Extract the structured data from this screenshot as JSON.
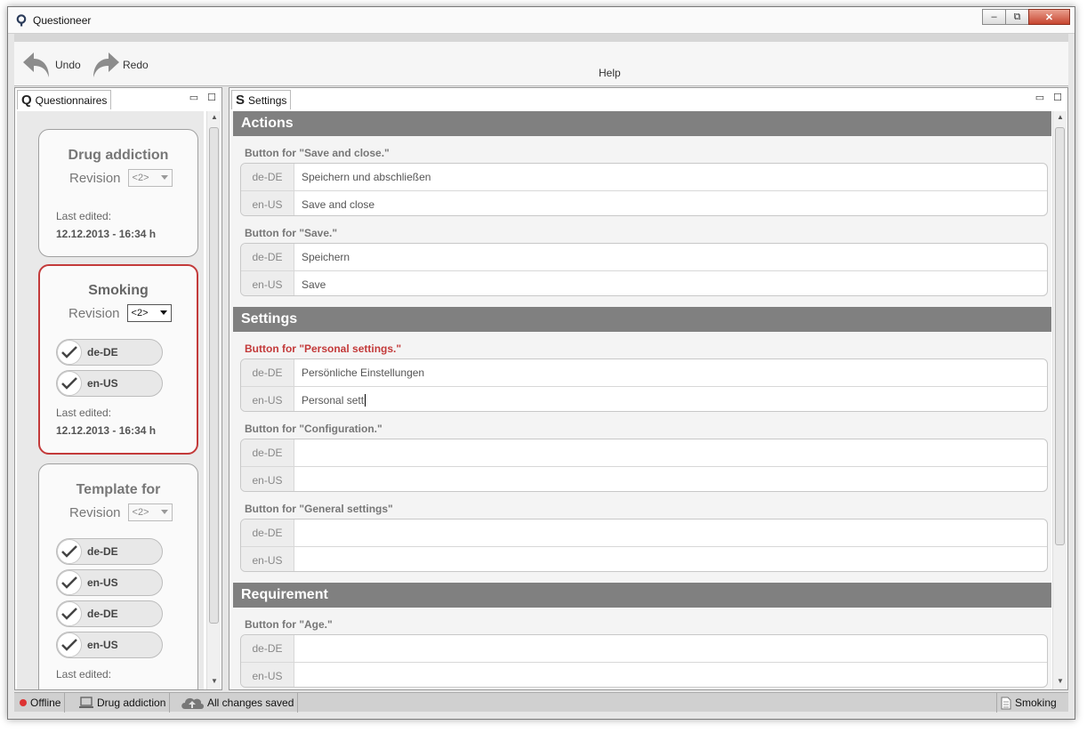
{
  "window": {
    "title": "Questioneer",
    "minimize": "‒",
    "maximize": "⧉",
    "close": "✕"
  },
  "toolbar": {
    "undo_label": "Undo",
    "redo_label": "Redo",
    "help_label": "Help"
  },
  "left_panel": {
    "tab_glyph": "Q",
    "tab_label": "Questionnaires",
    "minimize": "▭",
    "maximize": "☐",
    "cards": [
      {
        "title": "Drug addiction",
        "revision_label": "Revision",
        "revision_value": "<2>",
        "last_edited_label": "Last edited:",
        "last_edited": "12.12.2013 - 16:34 h"
      },
      {
        "title": "Smoking",
        "revision_label": "Revision",
        "revision_value": "<2>",
        "languages": [
          "de-DE",
          "en-US"
        ],
        "last_edited_label": "Last edited:",
        "last_edited": "12.12.2013 - 16:34 h"
      },
      {
        "title": "Template for",
        "revision_label": "Revision",
        "revision_value": "<2>",
        "languages": [
          "de-DE",
          "en-US",
          "de-DE",
          "en-US"
        ],
        "last_edited_label": "Last edited:"
      }
    ]
  },
  "right_panel": {
    "tab_glyph": "S",
    "tab_label": "Settings",
    "minimize": "▭",
    "maximize": "☐",
    "sections": [
      {
        "title": "Actions"
      },
      {
        "title": "Settings"
      },
      {
        "title": "Requirement"
      }
    ],
    "fields": [
      {
        "label": "Button for \"Save and close.\"",
        "de": "Speichern und abschließen",
        "en": "Save and close"
      },
      {
        "label": "Button for \"Save.\"",
        "de": "Speichern",
        "en": "Save"
      },
      {
        "label": "Button for \"Personal settings.\"",
        "de": "Persönliche Einstellungen",
        "en": "Personal sett"
      },
      {
        "label": "Button for \"Configuration.\"",
        "de": "",
        "en": ""
      },
      {
        "label": "Button for \"General settings\"",
        "de": "",
        "en": ""
      },
      {
        "label": "Button for \"Age.\"",
        "de": "",
        "en": ""
      }
    ],
    "lang_de": "de-DE",
    "lang_en": "en-US"
  },
  "status": {
    "connection": "Offline",
    "questionnaire": "Drug addiction",
    "save_state": "All changes saved",
    "document": "Smoking"
  },
  "colors": {
    "accent_red": "#c33a3a",
    "section_header": "#808080",
    "offline_dot": "#dd3333"
  }
}
